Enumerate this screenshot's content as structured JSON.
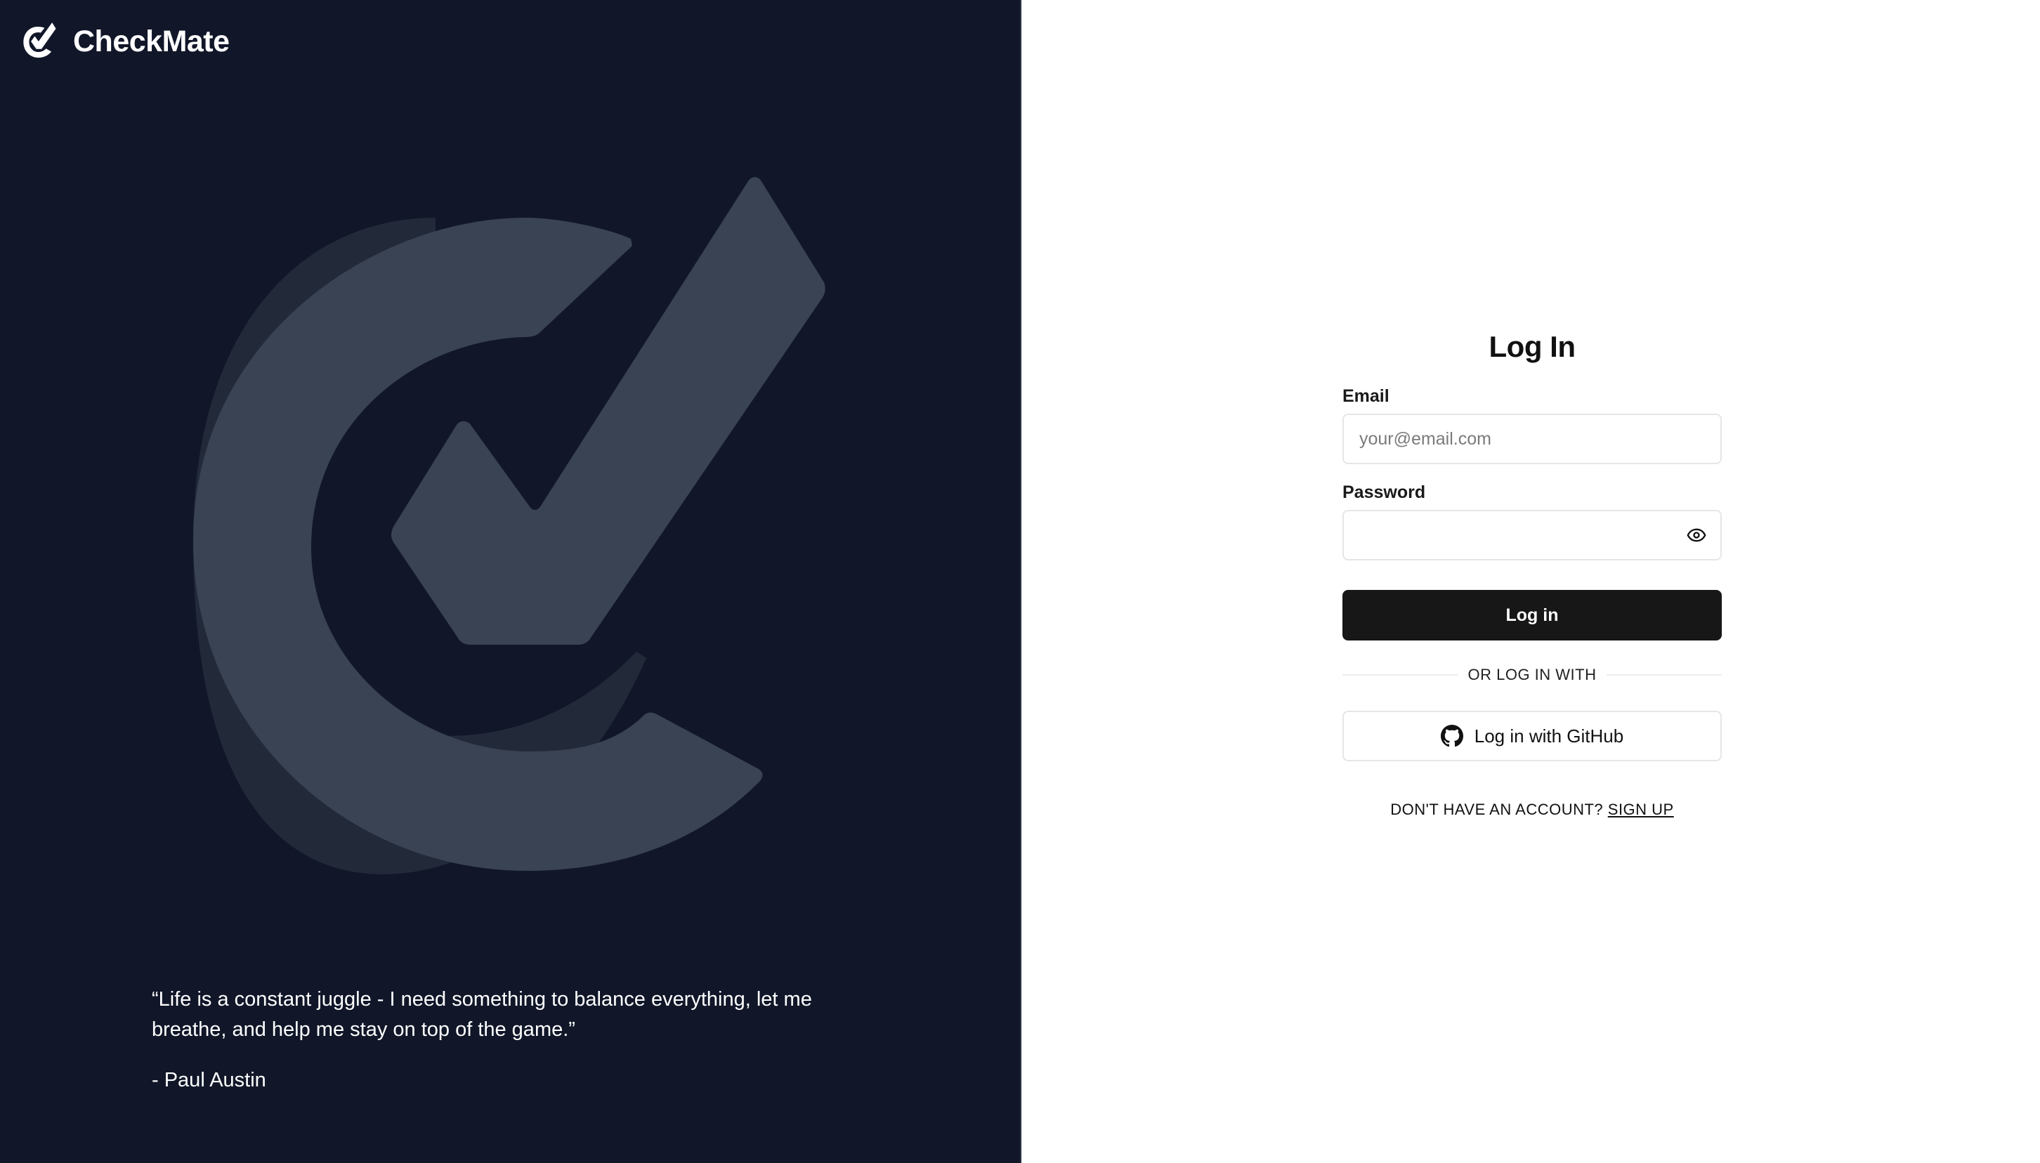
{
  "brand": {
    "name": "CheckMate",
    "colors": {
      "panel_background": "#111729",
      "logo_primary": "#394354",
      "logo_shadow": "#222a3a"
    }
  },
  "quote": {
    "text": "“Life is a constant juggle - I need something to balance everything, let me breathe, and help me stay on top of the game.”",
    "author": "- Paul Austin"
  },
  "login": {
    "title": "Log In",
    "email": {
      "label": "Email",
      "placeholder": "your@email.com",
      "value": ""
    },
    "password": {
      "label": "Password",
      "value": "",
      "toggle_icon": "eye-icon"
    },
    "submit_label": "Log in",
    "divider_text": "OR LOG IN WITH",
    "github": {
      "label": "Log in with GitHub",
      "icon": "github-icon"
    },
    "signup": {
      "prompt": "DON'T HAVE AN ACCOUNT?",
      "link_label": "SIGN UP"
    },
    "colors": {
      "primary_button": "#171717",
      "input_border": "#e6e6e6"
    }
  }
}
